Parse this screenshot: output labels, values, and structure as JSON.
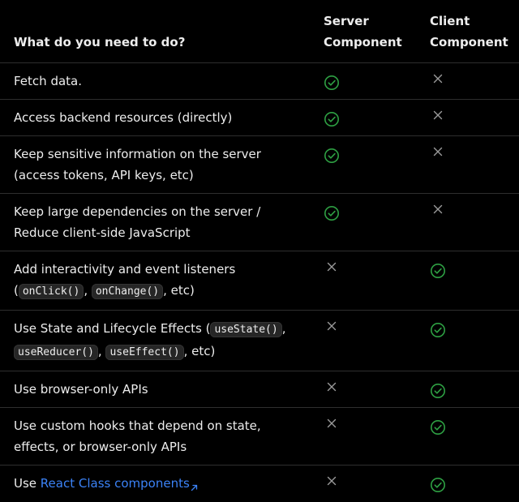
{
  "header": {
    "task": "What do you need to do?",
    "server_line1": "Server",
    "server_line2": "Component",
    "client_line1": "Client",
    "client_line2": "Component"
  },
  "colors": {
    "check": "#2ea043",
    "cross": "#9a9a9a",
    "link": "#3b82f6",
    "divider": "#2e2e2e"
  },
  "rows": [
    {
      "parts": [
        {
          "t": "text",
          "v": "Fetch data."
        }
      ],
      "server": "check-icon",
      "client": "cross-icon"
    },
    {
      "parts": [
        {
          "t": "text",
          "v": "Access backend resources (directly)"
        }
      ],
      "server": "check-icon",
      "client": "cross-icon"
    },
    {
      "parts": [
        {
          "t": "text",
          "v": "Keep sensitive information on the server (access tokens, API keys, etc)"
        }
      ],
      "server": "check-icon",
      "client": "cross-icon"
    },
    {
      "parts": [
        {
          "t": "text",
          "v": "Keep large dependencies on the server / Reduce client-side JavaScript"
        }
      ],
      "server": "check-icon",
      "client": "cross-icon"
    },
    {
      "parts": [
        {
          "t": "text",
          "v": "Add interactivity and event listeners ("
        },
        {
          "t": "code",
          "v": "onClick()"
        },
        {
          "t": "text",
          "v": ", "
        },
        {
          "t": "code",
          "v": "onChange()"
        },
        {
          "t": "text",
          "v": ", etc)"
        }
      ],
      "server": "cross-icon",
      "client": "check-icon"
    },
    {
      "parts": [
        {
          "t": "text",
          "v": "Use State and Lifecycle Effects ("
        },
        {
          "t": "code",
          "v": "useState()"
        },
        {
          "t": "text",
          "v": ", "
        },
        {
          "t": "code",
          "v": "useReducer()"
        },
        {
          "t": "text",
          "v": ", "
        },
        {
          "t": "code",
          "v": "useEffect()"
        },
        {
          "t": "text",
          "v": ", etc)"
        }
      ],
      "server": "cross-icon",
      "client": "check-icon"
    },
    {
      "parts": [
        {
          "t": "text",
          "v": "Use browser-only APIs"
        }
      ],
      "server": "cross-icon",
      "client": "check-icon"
    },
    {
      "parts": [
        {
          "t": "text",
          "v": "Use custom hooks that depend on state, effects, or browser-only APIs"
        }
      ],
      "server": "cross-icon",
      "client": "check-icon"
    },
    {
      "parts": [
        {
          "t": "text",
          "v": "Use "
        },
        {
          "t": "link",
          "v": "React Class components"
        }
      ],
      "server": "cross-icon",
      "client": "check-icon"
    }
  ]
}
